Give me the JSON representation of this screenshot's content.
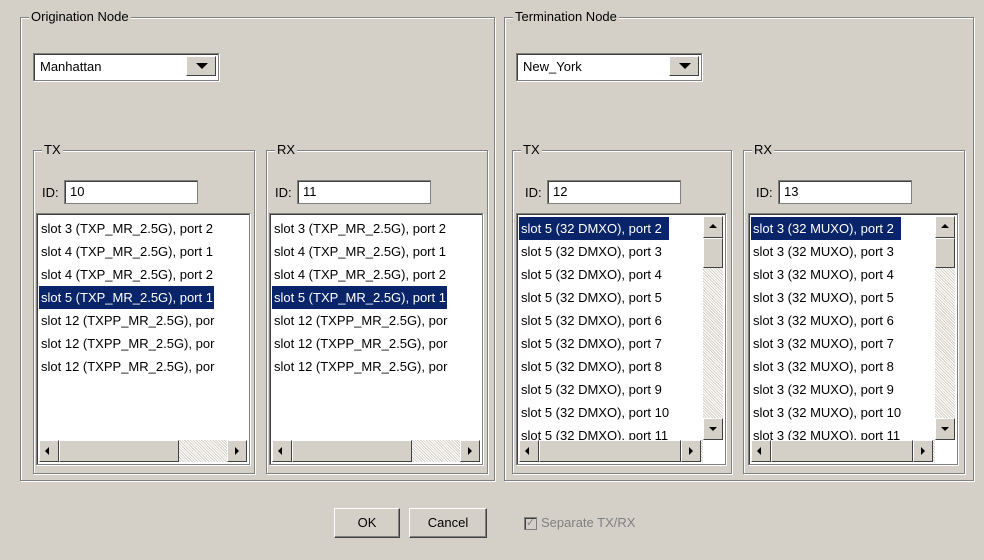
{
  "origination": {
    "title": "Origination Node",
    "node_value": "Manhattan",
    "tx": {
      "title": "TX",
      "id_label": "ID:",
      "id_value": "10",
      "rows": [
        "slot  3 (TXP_MR_2.5G), port 2",
        "slot  4 (TXP_MR_2.5G), port 1",
        "slot  4 (TXP_MR_2.5G), port 2",
        "slot  5 (TXP_MR_2.5G), port 1",
        "slot 12 (TXPP_MR_2.5G), por",
        "slot 12 (TXPP_MR_2.5G), por",
        "slot 12 (TXPP_MR_2.5G), por"
      ],
      "selected_index": 3
    },
    "rx": {
      "title": "RX",
      "id_label": "ID:",
      "id_value": "11",
      "rows": [
        "slot  3 (TXP_MR_2.5G), port 2",
        "slot  4 (TXP_MR_2.5G), port 1",
        "slot  4 (TXP_MR_2.5G), port 2",
        "slot  5 (TXP_MR_2.5G), port 1",
        "slot 12 (TXPP_MR_2.5G), por",
        "slot 12 (TXPP_MR_2.5G), por",
        "slot 12 (TXPP_MR_2.5G), por"
      ],
      "selected_index": 3
    }
  },
  "termination": {
    "title": "Termination Node",
    "node_value": "New_York",
    "tx": {
      "title": "TX",
      "id_label": "ID:",
      "id_value": "12",
      "rows": [
        "slot  5 (32 DMXO), port 2",
        "slot  5 (32 DMXO), port 3",
        "slot  5 (32 DMXO), port 4",
        "slot  5 (32 DMXO), port 5",
        "slot  5 (32 DMXO), port 6",
        "slot  5 (32 DMXO), port 7",
        "slot  5 (32 DMXO), port 8",
        "slot  5 (32 DMXO), port 9",
        "slot  5 (32 DMXO), port 10",
        "slot  5 (32 DMXO), port 11"
      ],
      "selected_index": 0
    },
    "rx": {
      "title": "RX",
      "id_label": "ID:",
      "id_value": "13",
      "rows": [
        "slot  3 (32 MUXO), port 2",
        "slot  3 (32 MUXO), port 3",
        "slot  3 (32 MUXO), port 4",
        "slot  3 (32 MUXO), port 5",
        "slot  3 (32 MUXO), port 6",
        "slot  3 (32 MUXO), port 7",
        "slot  3 (32 MUXO), port 8",
        "slot  3 (32 MUXO), port 9",
        "slot  3 (32 MUXO), port 10",
        "slot  3 (32 MUXO), port 11"
      ],
      "selected_index": 0
    }
  },
  "buttons": {
    "ok": "OK",
    "cancel": "Cancel"
  },
  "separate_checkbox": {
    "label": "Separate TX/RX",
    "checked": true,
    "check_glyph": "✓"
  },
  "colors": {
    "selection": "#0a246a",
    "background": "#d4d0c8"
  }
}
